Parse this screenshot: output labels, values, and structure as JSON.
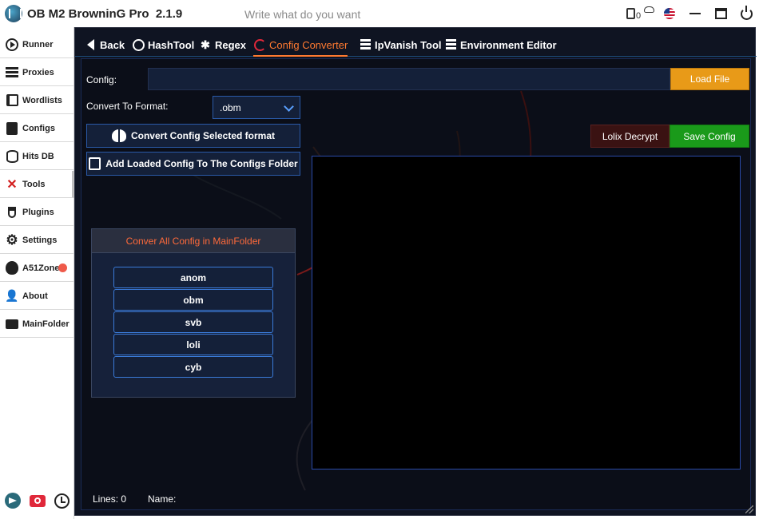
{
  "app": {
    "title": "OB M2 BrowninG Pro  2.1.9",
    "search_placeholder": "Write what do you want",
    "notification_count": "0",
    "language_flag": "us-flag-icon"
  },
  "sidebar": {
    "items": [
      {
        "label": "Runner",
        "icon": "play-circle-icon"
      },
      {
        "label": "Proxies",
        "icon": "server-list-icon"
      },
      {
        "label": "Wordlists",
        "icon": "book-icon"
      },
      {
        "label": "Configs",
        "icon": "config-icon"
      },
      {
        "label": "Hits DB",
        "icon": "database-icon"
      },
      {
        "label": "Tools",
        "icon": "tools-icon",
        "active": true,
        "accent": "#d32020"
      },
      {
        "label": "Plugins",
        "icon": "plug-icon"
      },
      {
        "label": "Settings",
        "icon": "gear-icon"
      },
      {
        "label": "A51Zone",
        "icon": "alien-icon",
        "notification": true,
        "notification_color": "#ef5a4a"
      },
      {
        "label": "About",
        "icon": "user-question-icon"
      },
      {
        "label": "MainFolder",
        "icon": "folder-icon"
      }
    ],
    "bottom_icons": [
      "telegram-icon",
      "camera-icon",
      "history-icon"
    ]
  },
  "tabs": [
    {
      "label": "Back",
      "icon": "back-arrow-icon"
    },
    {
      "label": "HashTool",
      "icon": "crosshair-icon"
    },
    {
      "label": "Regex",
      "icon": "regex-icon"
    },
    {
      "label": "Config Converter",
      "icon": "convert-icon",
      "active": true,
      "accent": "#ff7a30"
    },
    {
      "label": "IpVanish Tool",
      "icon": "list-icon"
    },
    {
      "label": "Environment Editor",
      "icon": "list-icon"
    }
  ],
  "converter": {
    "config_label": "Config:",
    "config_value": "",
    "load_file_label": "Load File",
    "convert_to_label": "Convert To Format:",
    "selected_format": ".obm",
    "convert_button_label": "Convert Config Selected format",
    "add_loaded_label": "Add Loaded Config To The Configs Folder",
    "lolix_decrypt_label": "Lolix Decrypt",
    "save_config_label": "Save Config",
    "group_title": "Conver All Config in MainFolder",
    "formats": [
      "anom",
      "obm",
      "svb",
      "loli",
      "cyb"
    ]
  },
  "status": {
    "lines_label": "Lines:",
    "lines_value": "0",
    "name_label": "Name:",
    "name_value": ""
  },
  "colors": {
    "accent_orange": "#ff7a30",
    "load_button": "#e89a18",
    "save_button": "#1a9a1a",
    "decrypt_button": "#3a1212",
    "panel_bg": "#0f1422"
  }
}
